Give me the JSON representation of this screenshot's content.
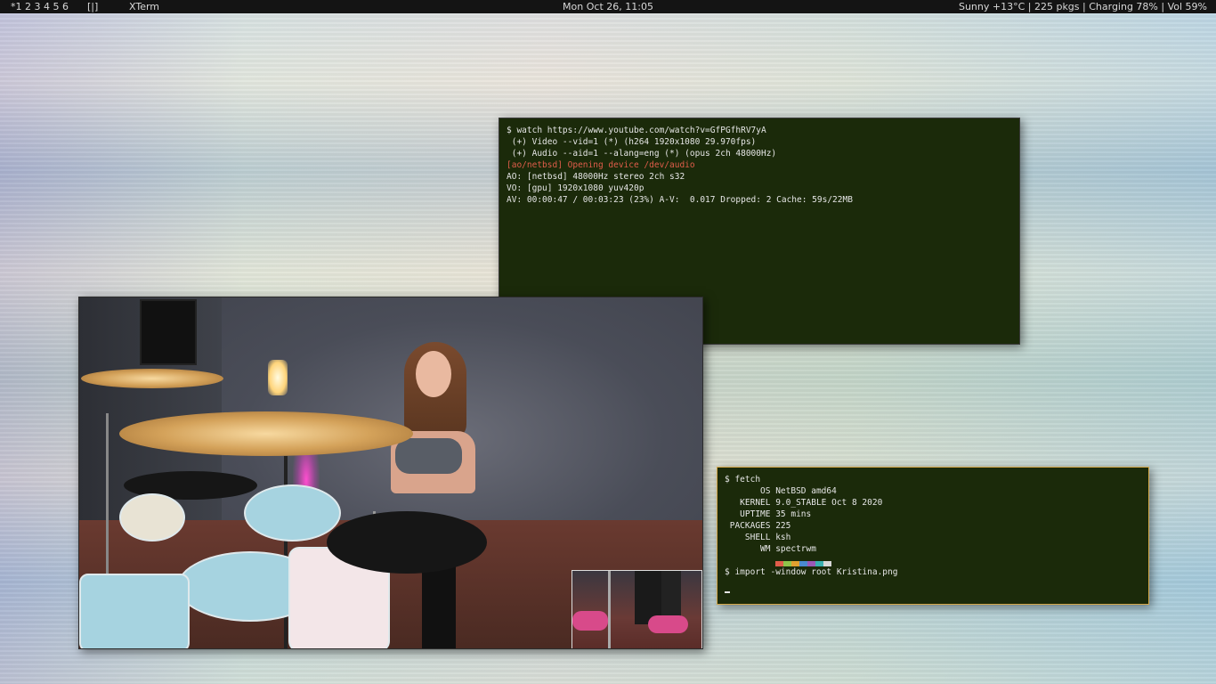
{
  "topbar": {
    "workspaces": "*1 2 3 4 5 6",
    "layout": "[|]",
    "window_title": "XTerm",
    "clock": "Mon Oct 26, 11:05",
    "status": "Sunny +13°C | 225 pkgs | Charging 78% | Vol  59%"
  },
  "term1": {
    "lines": [
      "$ watch https://www.youtube.com/watch?v=GfPGfhRV7yA",
      " (+) Video --vid=1 (*) (h264 1920x1080 29.970fps)",
      " (+) Audio --aid=1 --alang=eng (*) (opus 2ch 48000Hz)",
      "[ao/netbsd] Opening device /dev/audio",
      "AO: [netbsd] 48000Hz stereo 2ch s32",
      "VO: [gpu] 1920x1080 yuv420p",
      "AV: 00:00:47 / 00:03:23 (23%) A-V:  0.017 Dropped: 2 Cache: 59s/22MB"
    ]
  },
  "term2": {
    "lines": [
      "$ fetch",
      "       OS NetBSD amd64",
      "   KERNEL 9.0_STABLE Oct 8 2020",
      "   UPTIME 35 mins",
      " PACKAGES 225",
      "    SHELL ksh",
      "       WM spectrwm",
      "$ import -window root Kristina.png"
    ]
  },
  "colors": {
    "terminal_bg": "#1b2a0a",
    "error_text": "#e05d4a",
    "focused_border": "#d4a84a",
    "palette": [
      "#1b2a0a",
      "#e05d4a",
      "#8fc44a",
      "#e0a030",
      "#4a8ad0",
      "#9b59b6",
      "#3ab0b0",
      "#d8d8d8"
    ]
  }
}
